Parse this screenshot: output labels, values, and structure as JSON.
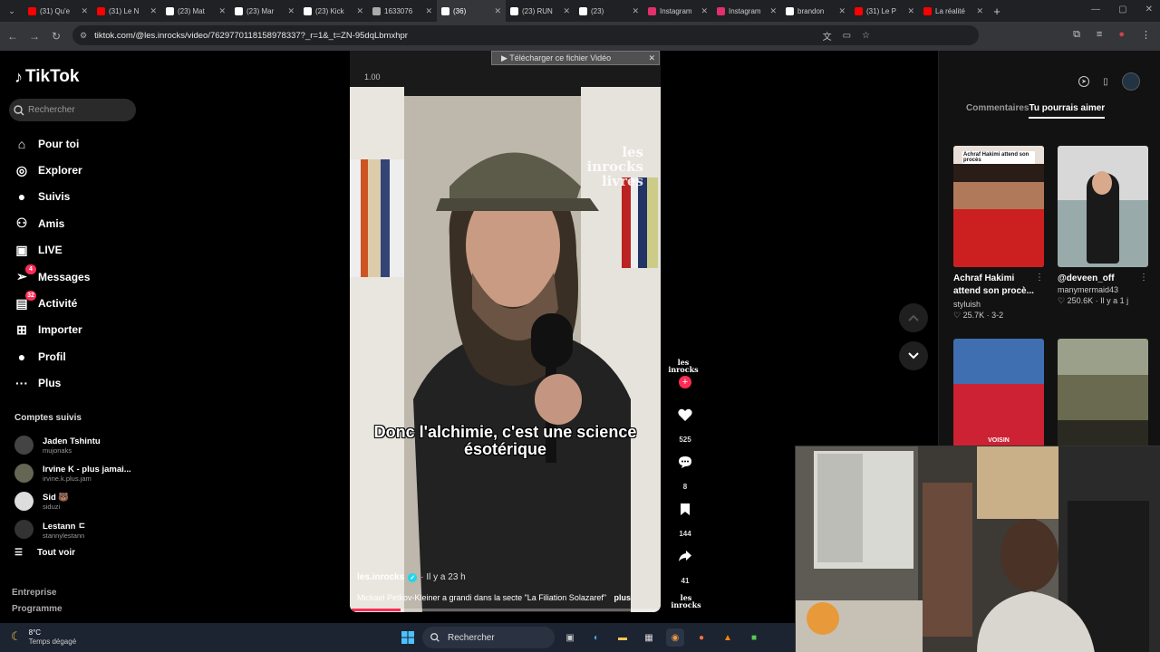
{
  "browser": {
    "tabs": [
      {
        "title": "(31) Qu'e",
        "icon": "youtube-icon",
        "color": "#ff0000"
      },
      {
        "title": "(31) Le N",
        "icon": "youtube-icon",
        "color": "#ff0000"
      },
      {
        "title": "(23) Mat",
        "icon": "x-icon",
        "color": "#ffffff"
      },
      {
        "title": "(23) Mar",
        "icon": "x-icon",
        "color": "#ffffff"
      },
      {
        "title": "(23) Kick",
        "icon": "x-icon",
        "color": "#ffffff"
      },
      {
        "title": "1633076",
        "icon": "globe-icon",
        "color": "#aaaaaa"
      },
      {
        "title": "(36)",
        "icon": "tiktok-icon",
        "color": "#ffffff",
        "active": true
      },
      {
        "title": "(23) RUN",
        "icon": "x-icon",
        "color": "#ffffff"
      },
      {
        "title": "(23)",
        "icon": "x-icon",
        "color": "#ffffff"
      },
      {
        "title": "Instagram",
        "icon": "instagram-icon",
        "color": "#e1306c"
      },
      {
        "title": "Instagram",
        "icon": "instagram-icon",
        "color": "#e1306c"
      },
      {
        "title": "brandon",
        "icon": "tiktok-icon",
        "color": "#ffffff"
      },
      {
        "title": "(31) Le P",
        "icon": "youtube-icon",
        "color": "#ff0000"
      },
      {
        "title": "La réalité",
        "icon": "youtube-icon",
        "color": "#ff0000"
      }
    ],
    "url": "tiktok.com/@les.inrocks/video/7629770118158978337?_r=1&_t=ZN-95dqLbmxhpr"
  },
  "sidebar": {
    "logo": "TikTok",
    "search_placeholder": "Rechercher",
    "nav": [
      {
        "label": "Pour toi",
        "icon": "home-icon"
      },
      {
        "label": "Explorer",
        "icon": "compass-icon"
      },
      {
        "label": "Suivis",
        "icon": "following-icon"
      },
      {
        "label": "Amis",
        "icon": "friends-icon"
      },
      {
        "label": "LIVE",
        "icon": "live-icon"
      },
      {
        "label": "Messages",
        "icon": "messages-icon",
        "badge": "4"
      },
      {
        "label": "Activité",
        "icon": "activity-icon",
        "badge": "32"
      },
      {
        "label": "Importer",
        "icon": "upload-icon"
      },
      {
        "label": "Profil",
        "icon": "profile-icon"
      },
      {
        "label": "Plus",
        "icon": "more-icon"
      }
    ],
    "following_title": "Comptes suivis",
    "following": [
      {
        "name": "Jaden Tshintu",
        "handle": "mujonaks",
        "color": "#444"
      },
      {
        "name": "Irvine K - plus jamai...",
        "handle": "irvine.k.plus.jam",
        "color": "#665"
      },
      {
        "name": "Sid 🐻",
        "handle": "siduzi",
        "color": "#ddd"
      },
      {
        "name": "Lestann ㄷ",
        "handle": "stannylestann",
        "color": "#333"
      }
    ],
    "see_all": "Tout voir",
    "footer": [
      "Entreprise",
      "Programme"
    ]
  },
  "video": {
    "download_bar": "▶ Télécharger ce fichier Vidéo",
    "time": "1.00",
    "watermark": "les inrocks livres",
    "caption": "Donc l'alchimie, c'est une science ésotérique",
    "author": "les.inrocks",
    "posted": "· Il y a 23 h",
    "description": "Mickael Petkov-Kleiner a grandi dans la secte \"La Filiation Solazaref\"",
    "more": "plus",
    "progress": 0.16,
    "actions": {
      "avatar_label": "les inrocks",
      "likes": "525",
      "comments": "8",
      "saves": "144",
      "shares": "41"
    }
  },
  "right_panel": {
    "tabs": [
      "Commentaires",
      "Tu pourrais aimer"
    ],
    "active_tab": 1,
    "cards": [
      {
        "title": "Achraf Hakimi attend son procè...",
        "author": "styluish",
        "stats": "♡ 25.7K · 3-2",
        "thumb_text": "Achraf Hakimi attend son procès"
      },
      {
        "title": "@deveen_off",
        "author": "manymermaid43",
        "stats": "♡ 250.6K · Il y a 1 j",
        "thumb_text": ""
      },
      {
        "title": "",
        "author": "",
        "stats": "",
        "thumb_text": "VOISIN"
      },
      {
        "title": "",
        "author": "",
        "stats": "",
        "thumb_text": ""
      }
    ]
  },
  "taskbar": {
    "temp": "8°C",
    "weather": "Temps dégagé",
    "search": "Rechercher"
  }
}
